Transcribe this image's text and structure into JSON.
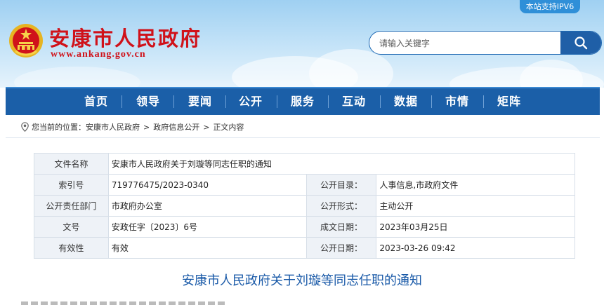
{
  "header": {
    "ipv6_badge": "本站支持IPV6",
    "site_title": "安康市人民政府",
    "site_url": "www.ankang.gov.cn",
    "search_placeholder": "请输入关键字",
    "accent_color": "#1b5fa8",
    "title_color": "#d0121a"
  },
  "nav": {
    "items": [
      {
        "label": "首页"
      },
      {
        "label": "领导"
      },
      {
        "label": "要闻"
      },
      {
        "label": "公开"
      },
      {
        "label": "服务"
      },
      {
        "label": "互动"
      },
      {
        "label": "数据"
      },
      {
        "label": "市情"
      },
      {
        "label": "矩阵"
      }
    ]
  },
  "breadcrumb": {
    "prefix": "您当前的位置：",
    "items": [
      "安康市人民政府",
      "政府信息公开",
      "正文内容"
    ],
    "separator": ">"
  },
  "meta": {
    "doc_name_label": "文件名称",
    "doc_name": "安康市人民政府关于刘璇等同志任职的通知",
    "index_label": "索引号",
    "index_value": "719776475/2023-0340",
    "catalog_label": "公开目录：",
    "catalog_value": "人事信息,市政府文件",
    "dept_label": "公开责任部门",
    "dept_value": "市政府办公室",
    "form_label": "公开形式：",
    "form_value": "主动公开",
    "docno_label": "文号",
    "docno_value": "安政任字〔2023〕6号",
    "created_label": "成文日期：",
    "created_value": "2023年03月25日",
    "valid_label": "有效性",
    "valid_value": "有效",
    "published_label": "公开日期：",
    "published_value": "2023-03-26 09:42"
  },
  "document": {
    "title": "安康市人民政府关于刘璇等同志任职的通知"
  }
}
